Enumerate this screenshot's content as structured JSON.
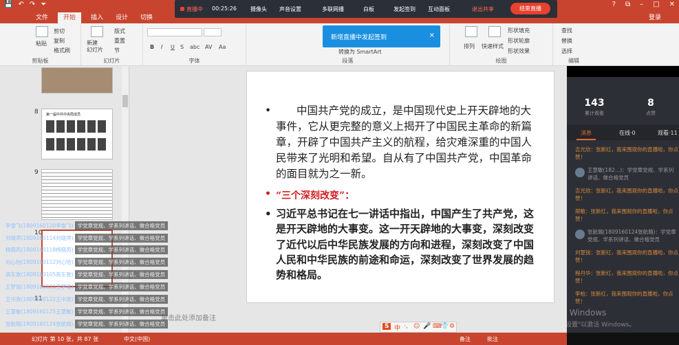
{
  "titlebar": {
    "quick_access": [
      "💾",
      "↶",
      "↷",
      "⏷"
    ],
    "window_controls": [
      "?",
      "⧉",
      "–",
      "□",
      "✕"
    ]
  },
  "tabs": [
    "文件",
    "开始",
    "插入",
    "设计",
    "切换"
  ],
  "login_label": "登录",
  "ribbon": {
    "clipboard": {
      "paste": "粘贴",
      "cut": "剪切",
      "copy": "复制",
      "format_painter": "格式刷",
      "group": "剪贴板"
    },
    "slides": {
      "new_slide": "新建\n幻灯片",
      "layout": "版式",
      "reset": "重置",
      "section": "节",
      "group": "幻灯片"
    },
    "font": {
      "group": "字体",
      "bold": "B",
      "italic": "I",
      "underline": "U",
      "strike": "S",
      "shadow": "abc",
      "spacing": "AV",
      "case": "Aa"
    },
    "paragraph": {
      "group": "段落",
      "smartart": "转换为 SmartArt"
    },
    "drawing": {
      "arrange": "排列",
      "quick_styles": "快速样式",
      "shape_fill": "形状填充",
      "shape_outline": "形状轮廓",
      "shape_effects": "形状效果",
      "group": "绘图"
    },
    "editing": {
      "find": "查找",
      "replace": "替换",
      "select": "选择",
      "group": "编辑"
    }
  },
  "live_toolbar": {
    "status": "直播中",
    "time": "00:25:26",
    "items": [
      "摄像头",
      "声音设置",
      "多联网播",
      "白板",
      "发起签到",
      "互动面板",
      "退出共享"
    ],
    "end_button": "结束直播"
  },
  "popup": {
    "message": "新增直播中发起签到",
    "close": "×"
  },
  "thumbs": {
    "n8": "8",
    "n9": "9",
    "n10": "10",
    "n11": "11",
    "thumb8_title": "第一届中共中央局成员"
  },
  "slide": {
    "bullet": "•",
    "paragraph1": "中国共产党的成立，是中国现代史上开天辟地的大事件，它从更完整的意义上揭开了中国民主革命的新篇章，开辟了中国共产主义的航程，给灾难深重的中国人民带来了光明和希望。自从有了中国共产党，中国革命的面目就为之一新。",
    "heading": "“三个深刻改变”：",
    "paragraph2": "习近平总书记在七一讲话中指出，中国产生了共产党，这是开天辟地的大事变。这一开天辟地的大事变，深刻改变了近代以后中华民族发展的方向和进程，深刻改变了中国人民和中华民族的前途和命运，深刻改变了世界发展的趋势和格局。",
    "notes": "单击此处添加备注"
  },
  "right_panel": {
    "views_count": "143",
    "views_label": "累计观看",
    "likes_count": "8",
    "likes_label": "点赞",
    "tab_messages": "消息",
    "tab_online": "在线·0",
    "tab_viewers": "观看·11",
    "messages": [
      {
        "text": "吉光欣：张新红，我来围观你的直播啦，你点赞！",
        "style": "orange"
      },
      {
        "text": "王慧敏(182…)：学党章党规、学系列讲话、做合格党员",
        "style": "gray"
      },
      {
        "text": "吉光欣：张新红，我来围观你的直播啦，你点赞！",
        "style": "orange"
      },
      {
        "text": "邢敏：张新红，我来围观你的直播啦，你点赞！",
        "style": "orange"
      },
      {
        "text": "张航璐(1809160124张航璐)：学党章党规、学系列讲话、做合格党员",
        "style": "gray"
      },
      {
        "text": "刘慧锐：张新红，我来围观你的直播啦，你点赞！",
        "style": "orange"
      },
      {
        "text": "程丹华：张新红，我来围观你的直播啦，你点赞！",
        "style": "orange"
      },
      {
        "text": "李柏：张新红，我来围观你的直播啦，你点赞！",
        "style": "orange"
      }
    ]
  },
  "comments": [
    {
      "name": "李雪飞(1809160120李雪飞)",
      "text": "学党章党规、学系列讲话、做合格党员"
    },
    {
      "name": "刘晓萍(1809160114刘晓萍)",
      "text": "学党章党规、学系列讲话、做合格党员"
    },
    {
      "name": "杨晓芮(1809160118杨晓芮)",
      "text": "学党章党规、学系列讲话、做合格党员"
    },
    {
      "name": "刘心怡(1809160112刘心怡)",
      "text": "学党章党规、学系列讲话、做合格党员"
    },
    {
      "name": "高东敦(1809160105高东敦)",
      "text": "学党章党规、学系列讲话、做合格党员"
    },
    {
      "name": "王梦瑶(1809160121王梦瑶)",
      "text": "学党章党规、学系列讲话、做合格党员"
    },
    {
      "name": "王中政(1809160122王中政)",
      "text": "学党章党规、学系列讲话、做合格党员"
    },
    {
      "name": "王慧敏(1809160125王慧敏)",
      "text": "学党章党规、学系列讲话、做合格党员"
    },
    {
      "name": "张航璐(1809160124张航璐)",
      "text": "学党章党规、学系列讲话、做合格党员"
    }
  ],
  "status": {
    "slide_of": "幻灯片 第 10 张，共 87 张",
    "lang": "中文(中国)",
    "notes": "备注",
    "comments": "批注"
  },
  "ime": {
    "logo": "S",
    "items": [
      "中",
      "·,",
      "☺",
      "🎤",
      "⌨",
      "👕",
      "⚙"
    ]
  },
  "watermark": {
    "line1": "激活 Windows",
    "line2": "转到\"设置\"以激活 Windows。"
  },
  "colors": {
    "accent": "#c8442e",
    "live_red": "#e8412d",
    "popup_blue": "#1a8fe0",
    "heading_red": "#d11c1c"
  }
}
